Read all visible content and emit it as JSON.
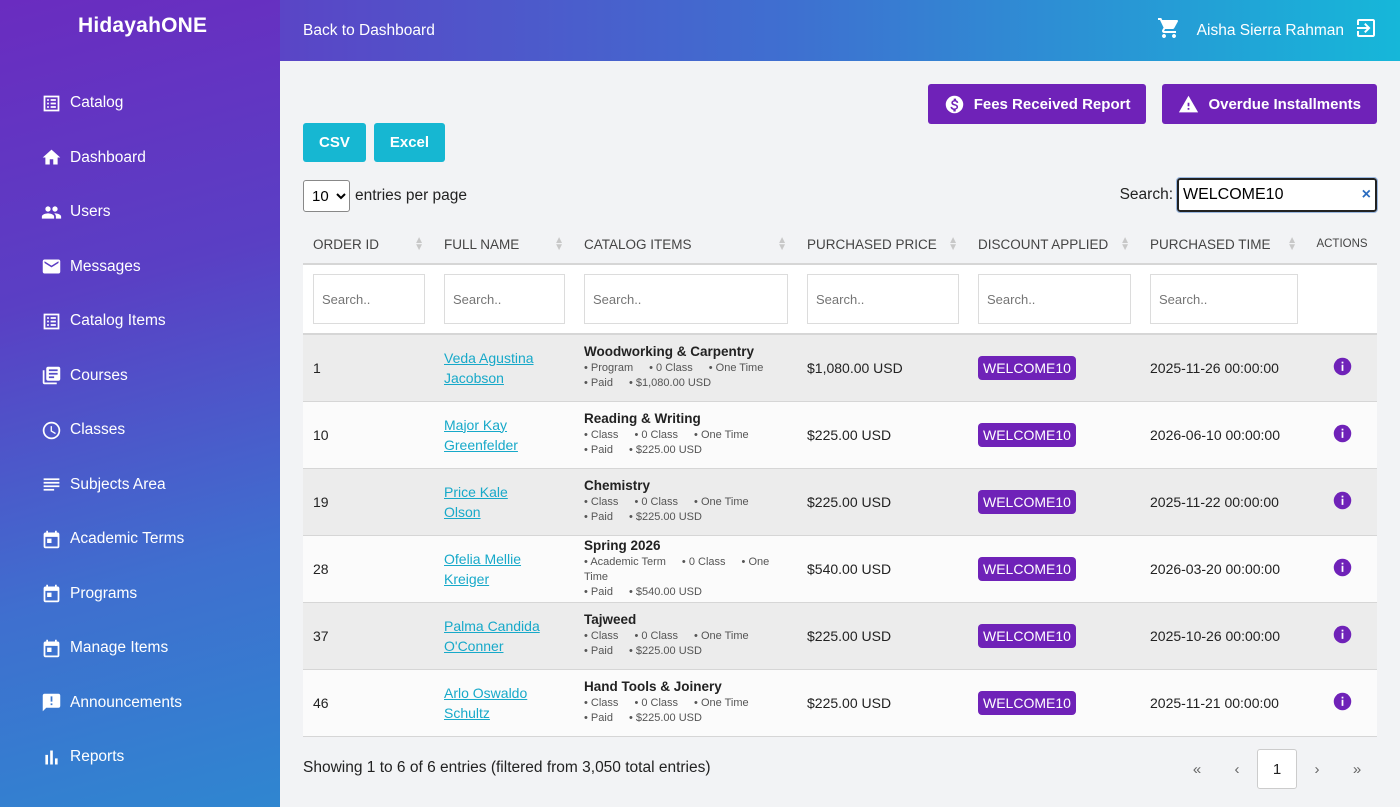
{
  "brand": "HidayahONE",
  "header": {
    "back_label": "Back to Dashboard",
    "user_name": "Aisha Sierra Rahman"
  },
  "sidebar": {
    "items": [
      {
        "label": "Catalog",
        "icon": "list-icon"
      },
      {
        "label": "Dashboard",
        "icon": "home-icon"
      },
      {
        "label": "Users",
        "icon": "people-icon"
      },
      {
        "label": "Messages",
        "icon": "mail-icon"
      },
      {
        "label": "Catalog Items",
        "icon": "list-icon"
      },
      {
        "label": "Courses",
        "icon": "library-icon"
      },
      {
        "label": "Classes",
        "icon": "clock-icon"
      },
      {
        "label": "Subjects Area",
        "icon": "lines-icon"
      },
      {
        "label": "Academic Terms",
        "icon": "calendar-icon"
      },
      {
        "label": "Programs",
        "icon": "calendar-icon"
      },
      {
        "label": "Manage Items",
        "icon": "calendar-icon"
      },
      {
        "label": "Announcements",
        "icon": "announcement-icon"
      },
      {
        "label": "Reports",
        "icon": "bar-chart-icon"
      }
    ]
  },
  "toolbar": {
    "fees_report": "Fees Received Report",
    "overdue": "Overdue Installments",
    "csv": "CSV",
    "excel": "Excel",
    "entries_value": "10",
    "entries_label": "entries per page",
    "search_label": "Search:",
    "search_value": "WELCOME10",
    "clear": "×"
  },
  "table": {
    "headers": [
      "ORDER ID",
      "FULL NAME",
      "CATALOG ITEMS",
      "PURCHASED PRICE",
      "DISCOUNT APPLIED",
      "PURCHASED TIME",
      "ACTIONS"
    ],
    "filter_placeholder": "Search..",
    "rows": [
      {
        "id": "1",
        "name": "Veda Agustina Jacobson",
        "item": "Woodworking & Carpentry",
        "type": "Program",
        "classes": "0 Class",
        "freq": "One Time",
        "status": "Paid",
        "amount": "$1,080.00 USD",
        "price": "$1,080.00 USD",
        "discount": "WELCOME10",
        "time": "2025-11-26 00:00:00"
      },
      {
        "id": "10",
        "name": "Major Kay Greenfelder",
        "item": "Reading & Writing",
        "type": "Class",
        "classes": "0 Class",
        "freq": "One Time",
        "status": "Paid",
        "amount": "$225.00 USD",
        "price": "$225.00 USD",
        "discount": "WELCOME10",
        "time": "2026-06-10 00:00:00"
      },
      {
        "id": "19",
        "name": "Price Kale Olson",
        "item": "Chemistry",
        "type": "Class",
        "classes": "0 Class",
        "freq": "One Time",
        "status": "Paid",
        "amount": "$225.00 USD",
        "price": "$225.00 USD",
        "discount": "WELCOME10",
        "time": "2025-11-22 00:00:00"
      },
      {
        "id": "28",
        "name": "Ofelia Mellie Kreiger",
        "item": "Spring 2026",
        "type": "Academic Term",
        "classes": "0 Class",
        "freq": "One Time",
        "status": "Paid",
        "amount": "$540.00 USD",
        "price": "$540.00 USD",
        "discount": "WELCOME10",
        "time": "2026-03-20 00:00:00"
      },
      {
        "id": "37",
        "name": "Palma Candida O'Conner",
        "item": "Tajweed",
        "type": "Class",
        "classes": "0 Class",
        "freq": "One Time",
        "status": "Paid",
        "amount": "$225.00 USD",
        "price": "$225.00 USD",
        "discount": "WELCOME10",
        "time": "2025-10-26 00:00:00"
      },
      {
        "id": "46",
        "name": "Arlo Oswaldo Schultz",
        "item": "Hand Tools & Joinery",
        "type": "Class",
        "classes": "0 Class",
        "freq": "One Time",
        "status": "Paid",
        "amount": "$225.00 USD",
        "price": "$225.00 USD",
        "discount": "WELCOME10",
        "time": "2025-11-21 00:00:00"
      }
    ]
  },
  "footer": {
    "info": "Showing 1 to 6 of 6 entries (filtered from 3,050 total entries)",
    "pager": {
      "first": "«",
      "prev": "‹",
      "current": "1",
      "next": "›",
      "last": "»"
    }
  },
  "colors": {
    "accent": "#6f22b8",
    "export": "#16b7d2",
    "link": "#17a9c9"
  }
}
